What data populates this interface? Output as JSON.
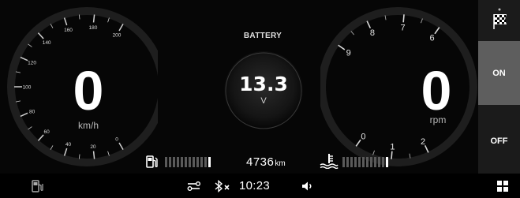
{
  "speed": {
    "value": "0",
    "unit": "km/h",
    "ticks": [
      "0",
      "20",
      "40",
      "60",
      "80",
      "100",
      "120",
      "140",
      "160",
      "180",
      "200"
    ],
    "colors": {
      "tick": "#c9c9c9",
      "digit": "#ffffff"
    }
  },
  "rpm": {
    "value": "0",
    "unit": "rpm",
    "ticks": [
      "0",
      "1",
      "2",
      "6",
      "7",
      "8",
      "9"
    ]
  },
  "battery": {
    "title": "BATTERY",
    "value": "13.3",
    "unit": "V"
  },
  "fuel": {
    "icon": "fuel-pump-icon",
    "bars": 12
  },
  "odometer": {
    "value": "4736",
    "unit": "km"
  },
  "coolant": {
    "icon": "coolant-temp-icon",
    "bars": 12
  },
  "side_panel": {
    "flag_icon": "checkered-flag-icon",
    "on_label": "ON",
    "off_label": "OFF",
    "active": "ON"
  },
  "status_bar": {
    "time": "10:23",
    "left_icon": "fuel-station-icon",
    "icons": [
      "key-icon",
      "bluetooth-off-icon",
      "volume-icon"
    ],
    "right_icon": "grid-menu-icon"
  },
  "colors": {
    "background": "#060606",
    "side_panel": "#1b1b1b",
    "on_active": "#5e5e5e",
    "accent": "#ffffff"
  }
}
